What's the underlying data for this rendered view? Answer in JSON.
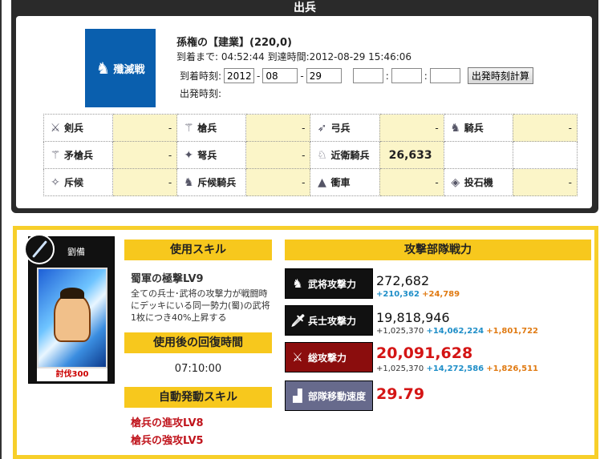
{
  "header": {
    "title": "出兵"
  },
  "banner": {
    "label": "殲滅戦",
    "icon": "horse-icon"
  },
  "target": {
    "name": "孫権の【建業】(220,0)"
  },
  "arrival": {
    "text": "到着まで: 04:52:44 到達時間:2012-08-29 15:46:06"
  },
  "time_form": {
    "label": "到着時刻:",
    "year": "2012",
    "month": "08",
    "day": "29",
    "hour": "",
    "minute": "",
    "second": "",
    "sep_date": "-",
    "sep_time": ":",
    "calc_button": "出発時刻計算",
    "depart_label": "出発時刻:"
  },
  "troops": [
    [
      {
        "name": "剣兵",
        "value": "-",
        "icon": "swordsman-icon"
      },
      {
        "name": "槍兵",
        "value": "-",
        "icon": "spearman-icon"
      },
      {
        "name": "弓兵",
        "value": "-",
        "icon": "archer-icon"
      },
      {
        "name": "騎兵",
        "value": "-",
        "icon": "cavalry-icon"
      }
    ],
    [
      {
        "name": "矛槍兵",
        "value": "-",
        "icon": "pikeman-icon"
      },
      {
        "name": "弩兵",
        "value": "-",
        "icon": "crossbowman-icon"
      },
      {
        "name": "近衛騎兵",
        "value": "26,633",
        "icon": "guard-cavalry-icon"
      },
      {
        "name": "",
        "value": "",
        "icon": ""
      }
    ],
    [
      {
        "name": "斥候",
        "value": "-",
        "icon": "scout-icon"
      },
      {
        "name": "斥候騎兵",
        "value": "-",
        "icon": "scout-cavalry-icon"
      },
      {
        "name": "衝車",
        "value": "-",
        "icon": "battering-ram-icon"
      },
      {
        "name": "投石機",
        "value": "-",
        "icon": "catapult-icon"
      }
    ]
  ],
  "card": {
    "name": "劉備",
    "footer": "討伐300",
    "weapon": "sword-icon"
  },
  "skill": {
    "header": "使用スキル",
    "name": "蜀軍の極撃LV9",
    "desc": "全ての兵士･武将の攻撃力が戦闘時にデッキにいる同一勢力(蜀)の武将1枚につき40%上昇する"
  },
  "recover": {
    "header": "使用後の回復時間",
    "time": "07:10:00"
  },
  "auto_skill": {
    "header": "自動発動スキル",
    "items": [
      "槍兵の進攻LV8",
      "槍兵の強攻LV5"
    ]
  },
  "power": {
    "header": "攻撃部隊戦力",
    "general": {
      "label": "武将攻撃力",
      "main": "272,682",
      "b": "+210,362",
      "o": "+24,789",
      "icon": "general-icon"
    },
    "soldier": {
      "label": "兵士攻撃力",
      "main": "19,818,946",
      "base": "+1,025,370",
      "b": "+14,062,224",
      "o": "+1,801,722",
      "icon": "sword-icon"
    },
    "total": {
      "label": "総攻撃力",
      "main": "20,091,628",
      "base": "+1,025,370",
      "b": "+14,272,586",
      "o": "+1,826,511",
      "icon": "crossed-swords-icon"
    },
    "speed": {
      "label": "部隊移動速度",
      "main": "29.79",
      "icon": "boot-icon"
    }
  }
}
